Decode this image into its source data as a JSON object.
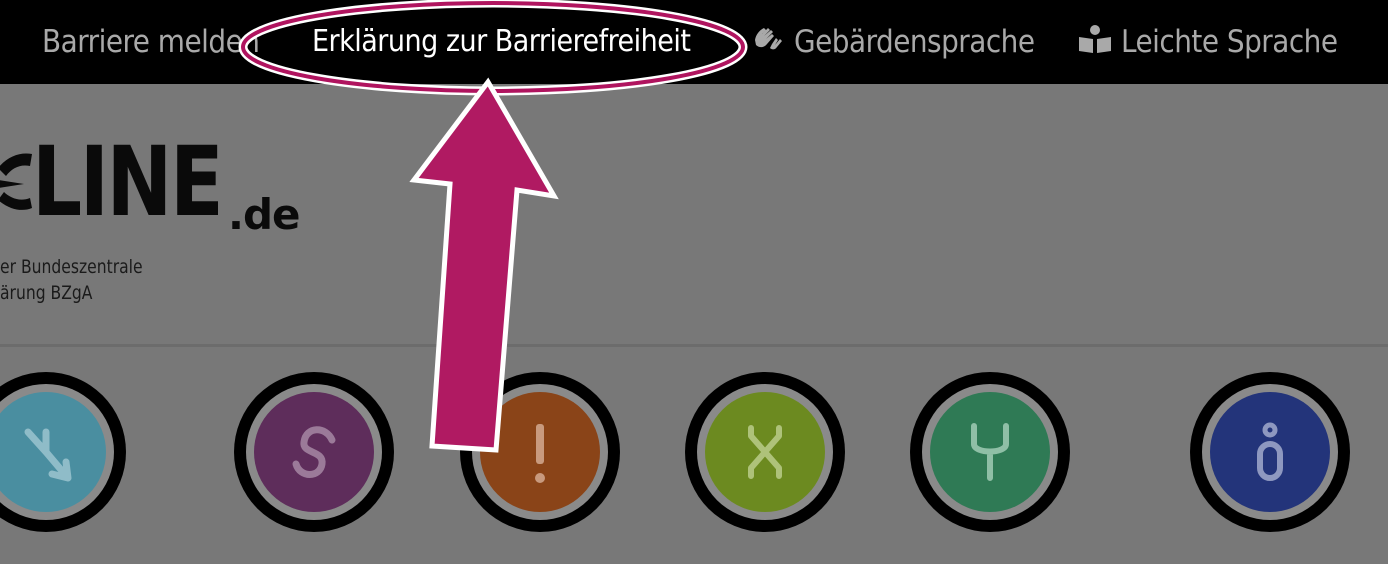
{
  "nav": {
    "items": [
      {
        "label": "Barriere melden",
        "icon": "none"
      },
      {
        "label": "Erklärung zur Barrierefreiheit",
        "icon": "none",
        "active": true
      },
      {
        "label": "Gebärdensprache",
        "icon": "sign-language-hands-icon"
      },
      {
        "label": "Leichte Sprache",
        "icon": "book-reader-icon"
      }
    ]
  },
  "logo": {
    "name_visible": "LINE",
    "tld": ".de",
    "tagline_line1": "er Bundeszentrale",
    "tagline_line2": "ärung BZgA"
  },
  "topics": [
    {
      "icon": "split-arrows-icon",
      "color": "#4a8ea0"
    },
    {
      "icon": "s-curve-icon",
      "color": "#5e2d5b"
    },
    {
      "icon": "exclamation-icon",
      "color": "#8a4418"
    },
    {
      "icon": "x-symbol-icon",
      "color": "#6c8a20"
    },
    {
      "icon": "y-symbol-icon",
      "color": "#2f7a55"
    },
    {
      "icon": "figure-icon",
      "color": "#23347a"
    }
  ],
  "annotation": {
    "highlight_color": "#b0145f",
    "arrow_color": "#b01a62"
  }
}
